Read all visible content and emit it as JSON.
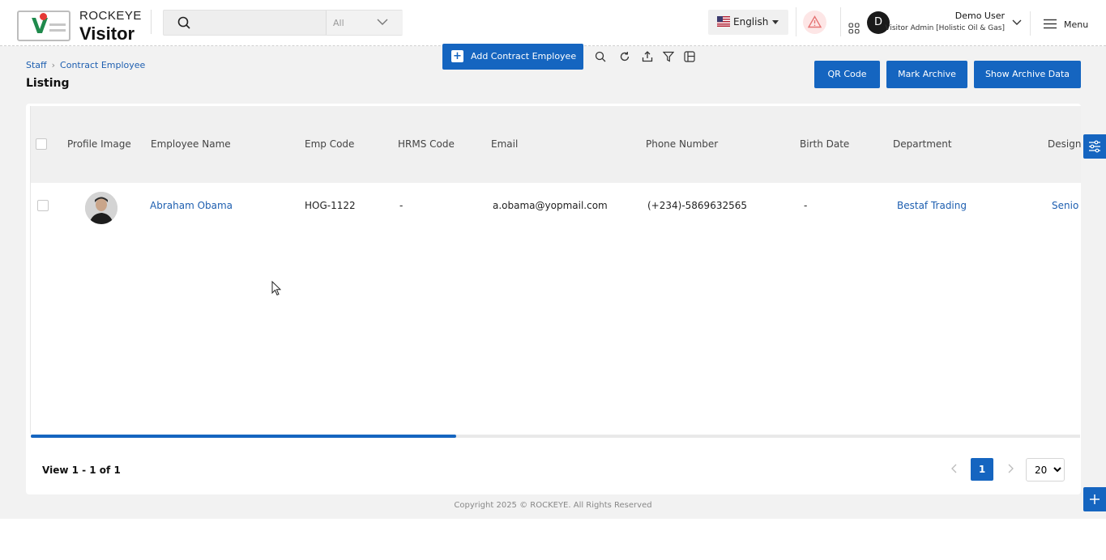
{
  "header": {
    "logo_top": "ROCKEYE",
    "logo_bottom": "Visitor",
    "search_placeholder": "",
    "search_filter": "All",
    "language": "English",
    "user_initial": "D",
    "user_name": "Demo User",
    "user_role": "Visitor Admin [Holistic Oil & Gas]",
    "menu_label": "Menu"
  },
  "breadcrumb": {
    "items": [
      "Staff",
      "Contract Employee"
    ]
  },
  "page_title": "Listing",
  "toolbar": {
    "add_label": "Add Contract Employee",
    "icons": [
      "search-icon",
      "refresh-icon",
      "export-icon",
      "filter-icon",
      "columns-icon"
    ]
  },
  "actions": {
    "qr_label": "QR Code",
    "archive_label": "Mark Archive",
    "show_archive_label": "Show Archive Data"
  },
  "table": {
    "columns": [
      "Profile Image",
      "Employee Name",
      "Emp Code",
      "HRMS Code",
      "Email",
      "Phone Number",
      "Birth Date",
      "Department",
      "Designa"
    ],
    "rows": [
      {
        "employee_name": "Abraham Obama",
        "emp_code": "HOG-1122",
        "hrms_code": "-",
        "email": "a.obama@yopmail.com",
        "phone": "(+234)-5869632565",
        "birth_date": "-",
        "department": "Bestaf Trading",
        "designation": "Senio"
      }
    ]
  },
  "pagination": {
    "view_count": "View 1 - 1 of 1",
    "current_page": "1",
    "page_size": "20",
    "page_size_options": [
      "20"
    ]
  },
  "footer": {
    "copyright": "Copyright 2025 © ROCKEYE. All Rights Reserved"
  },
  "colors": {
    "primary": "#1565c0",
    "link": "#1e5fb0",
    "alert_bg": "#fde6e6"
  }
}
